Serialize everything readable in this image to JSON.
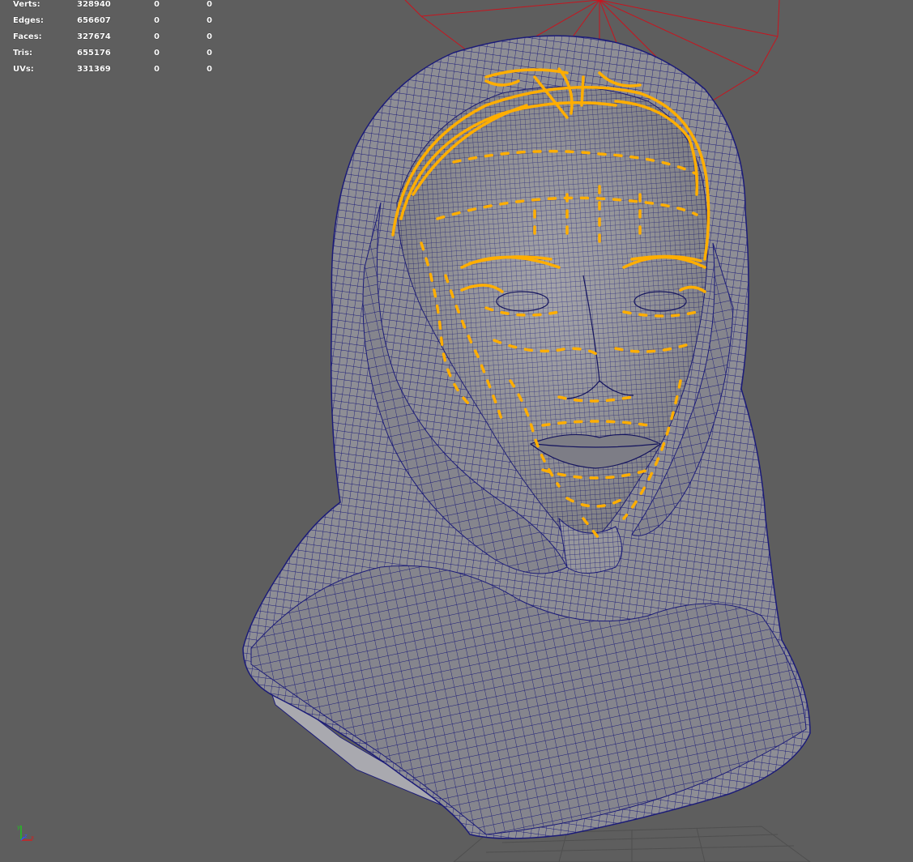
{
  "hud": {
    "rows": [
      {
        "label": "Verts:",
        "total": "328940",
        "selected": "0",
        "components": "0"
      },
      {
        "label": "Edges:",
        "total": "656607",
        "selected": "0",
        "components": "0"
      },
      {
        "label": "Faces:",
        "total": "327674",
        "selected": "0",
        "components": "0"
      },
      {
        "label": "Tris:",
        "total": "655176",
        "selected": "0",
        "components": "0"
      },
      {
        "label": "UVs:",
        "total": "331369",
        "selected": "0",
        "components": "0"
      }
    ]
  },
  "axis": {
    "y_label": "y",
    "z_label": "z",
    "x_label": "x"
  },
  "colors": {
    "background": "#5e5e5e",
    "mesh_fill": "#8f8f96",
    "wireframe": "#1c1c7a",
    "selection_curves": "#ffae00",
    "camera_frustum": "#c8141e",
    "grid": "#4e4e4e",
    "axis_x": "#d02020",
    "axis_y": "#20c020",
    "axis_z": "#3050ff"
  }
}
